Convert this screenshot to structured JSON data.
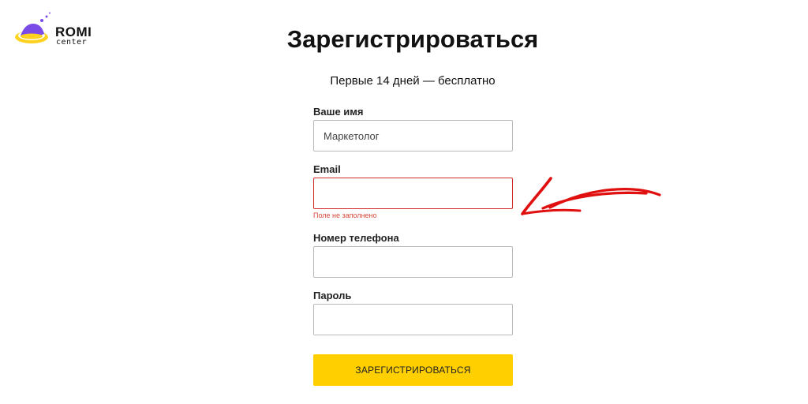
{
  "logo": {
    "word": "ROMI",
    "sub": "center",
    "colors": {
      "purple": "#7b4be8",
      "yellow": "#ffd21f"
    }
  },
  "header": {
    "title": "Зарегистрироваться",
    "subtitle": "Первые 14 дней — бесплатно"
  },
  "form": {
    "name": {
      "label": "Ваше имя",
      "value": "Маркетолог",
      "placeholder": ""
    },
    "email": {
      "label": "Email",
      "value": "",
      "placeholder": "",
      "error": "Поле не заполнено"
    },
    "phone": {
      "label": "Номер телефона",
      "value": "",
      "placeholder": ""
    },
    "password": {
      "label": "Пароль",
      "value": "",
      "placeholder": ""
    },
    "submit_label": "ЗАРЕГИСТРИРОВАТЬСЯ"
  },
  "colors": {
    "accent_button": "#ffcf00",
    "error_border": "#d22a2a",
    "error_text": "#d9483b",
    "annotation_arrow": "#e01010"
  },
  "annotation": {
    "icon": "hand-drawn-arrow-icon"
  }
}
